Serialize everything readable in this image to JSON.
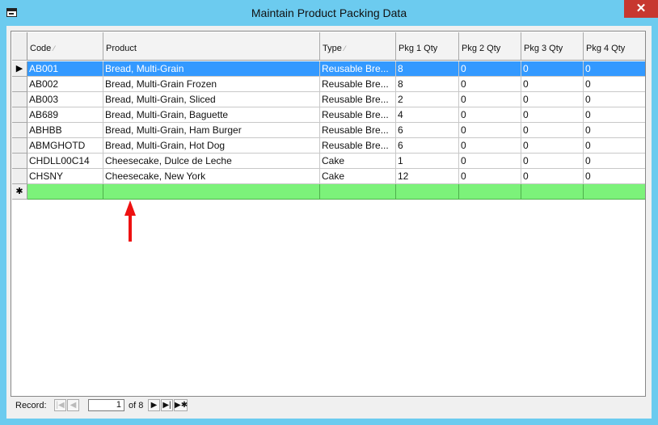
{
  "window": {
    "title": "Maintain Product Packing Data",
    "close": "✕"
  },
  "columns": [
    {
      "label": "Code",
      "sort": "⁄"
    },
    {
      "label": "Product",
      "sort": ""
    },
    {
      "label": "Type",
      "sort": "⁄"
    },
    {
      "label": "Pkg 1 Qty",
      "sort": ""
    },
    {
      "label": "Pkg 2 Qty",
      "sort": ""
    },
    {
      "label": "Pkg 3 Qty",
      "sort": ""
    },
    {
      "label": "Pkg 4 Qty",
      "sort": ""
    }
  ],
  "rows": [
    {
      "code": "AB001",
      "product": "Bread, Multi-Grain",
      "type": "Reusable Bre...",
      "pkg1": "8",
      "pkg2": "0",
      "pkg3": "0",
      "pkg4": "0"
    },
    {
      "code": "AB002",
      "product": "Bread, Multi-Grain Frozen",
      "type": "Reusable Bre...",
      "pkg1": "8",
      "pkg2": "0",
      "pkg3": "0",
      "pkg4": "0"
    },
    {
      "code": "AB003",
      "product": "Bread, Multi-Grain, Sliced",
      "type": "Reusable Bre...",
      "pkg1": "2",
      "pkg2": "0",
      "pkg3": "0",
      "pkg4": "0"
    },
    {
      "code": "AB689",
      "product": "Bread, Multi-Grain, Baguette",
      "type": "Reusable Bre...",
      "pkg1": "4",
      "pkg2": "0",
      "pkg3": "0",
      "pkg4": "0"
    },
    {
      "code": "ABHBB",
      "product": "Bread, Multi-Grain, Ham Burger",
      "type": "Reusable Bre...",
      "pkg1": "6",
      "pkg2": "0",
      "pkg3": "0",
      "pkg4": "0"
    },
    {
      "code": "ABMGHOTD",
      "product": "Bread, Multi-Grain, Hot Dog",
      "type": "Reusable Bre...",
      "pkg1": "6",
      "pkg2": "0",
      "pkg3": "0",
      "pkg4": "0"
    },
    {
      "code": "CHDLL00C14",
      "product": "Cheesecake, Dulce de Leche",
      "type": "Cake",
      "pkg1": "1",
      "pkg2": "0",
      "pkg3": "0",
      "pkg4": "0"
    },
    {
      "code": "CHSNY",
      "product": "Cheesecake, New York",
      "type": "Cake",
      "pkg1": "12",
      "pkg2": "0",
      "pkg3": "0",
      "pkg4": "0"
    }
  ],
  "selector": {
    "current": "▶",
    "new": "✱"
  },
  "navigator": {
    "label": "Record:",
    "first": "|◀",
    "prev": "◀",
    "current": "1",
    "of": "of 8",
    "next": "▶",
    "last": "▶|",
    "new": "▶✱"
  },
  "colors": {
    "selected_row": "#3399ff",
    "new_row": "#7cf27a",
    "annotation_arrow": "#ee1111"
  }
}
